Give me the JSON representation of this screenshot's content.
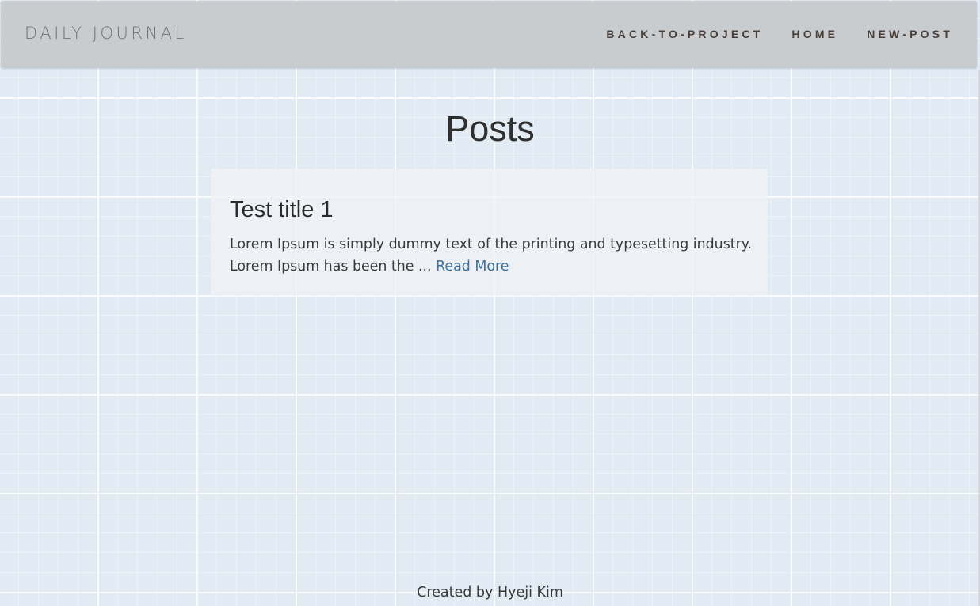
{
  "navbar": {
    "brand": "DAILY JOURNAL",
    "links": [
      {
        "label": "BACK-TO-PROJECT"
      },
      {
        "label": "HOME"
      },
      {
        "label": "NEW-POST"
      }
    ]
  },
  "main": {
    "title": "Posts",
    "posts": [
      {
        "title": "Test title 1",
        "excerpt": "Lorem Ipsum is simply dummy text of the printing and typesetting industry. Lorem Ipsum has been the ... ",
        "read_more": "Read More"
      }
    ]
  },
  "footer": {
    "text": "Created by Hyeji Kim"
  },
  "colors": {
    "background": "#e2ebf4",
    "navbar": "#c9cccf",
    "link_accent": "#3e72a6"
  }
}
